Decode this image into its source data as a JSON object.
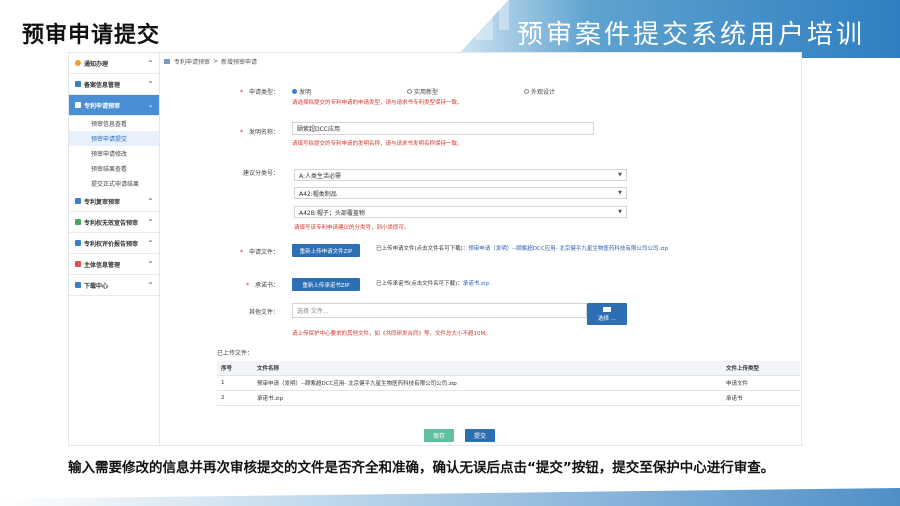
{
  "slide": {
    "title": "预审申请提交",
    "banner": "预审案件提交系统用户培训",
    "caption": "输入需要修改的信息并再次审核提交的文件是否齐全和准确，确认无误后点击“提交”按钮，提交至保护中心进行审查。"
  },
  "sidebar": {
    "items": [
      {
        "label": "通知办理",
        "icon": "bell-icon",
        "chevron": "^"
      },
      {
        "label": "备案信息管理",
        "icon": "folder-icon",
        "chevron": "^"
      },
      {
        "label": "专利申请预审",
        "icon": "document-icon",
        "chevron": "⌄"
      },
      {
        "label": "专利复审预审",
        "icon": "folder-icon",
        "chevron": "^"
      },
      {
        "label": "专利权无效宣告预审",
        "icon": "document-icon",
        "chevron": "^"
      },
      {
        "label": "专利权评价报告预审",
        "icon": "folder-icon",
        "chevron": "^"
      },
      {
        "label": "主体信息管理",
        "icon": "user-icon",
        "chevron": "^"
      },
      {
        "label": "下载中心",
        "icon": "download-icon",
        "chevron": "^"
      }
    ],
    "subitems": [
      "预审信息查看",
      "预审申请提交",
      "预审申请修改",
      "预审结果查看",
      "提交正式申请结果"
    ]
  },
  "breadcrumb": {
    "part1": "专利申请预审",
    "sep": ">",
    "part2": "新增预审申请"
  },
  "form": {
    "type_label": "申请类型：",
    "type_options": [
      "发明",
      "实用新型",
      "外观设计"
    ],
    "type_hint": "请选择拟提交的专利申请的申请类型，请与请求书专利类型保持一致。",
    "name_label": "发明名称：",
    "name_value": "颐紫超DCC应用",
    "name_hint": "请填写拟提交的专利申请的发明名称，请与请求书发明名称保持一致。",
    "class_label": "建议分类号：",
    "class_selects": [
      "A:人类生活必需",
      "A42:帽类制品",
      "A42B:帽子；头部覆盖物"
    ],
    "class_hint": "请填写该专利申请建议的分类号，到小类即可。",
    "app_file_label": "申请文件：",
    "app_file_button": "重新上传申请文件ZIP",
    "app_file_info_prefix": "已上传申请文件(点击文件名可下载)：",
    "app_file_info_link": "预审申请（发明）--颐紫超DCC应用- 北京健平九星生物医药科技有限公司公司.zip",
    "commit_label": "承诺书：",
    "commit_button": "重新上传承诺书ZIP",
    "commit_info_prefix": "已上传承诺书(点击文件名可下载)：",
    "commit_info_link": "承诺书.zip",
    "other_label": "其他文件：",
    "other_placeholder": "选择 文件...",
    "other_button": "选择 ...",
    "other_hint": "请上传保护中心要求的其他文件，如《共同研发合同》等，文件总大小不超10M。"
  },
  "uploaded": {
    "label": "已上传文件：",
    "headers": [
      "序号",
      "文件名称",
      "文件上传类型"
    ],
    "rows": [
      [
        "1",
        "预审申请（发明）--颐紫超DCC应用- 北京健平九星生物医药科技有限公司公司.zip",
        "申请文件"
      ],
      [
        "2",
        "承诺书.zip",
        "承诺书"
      ]
    ]
  },
  "actions": {
    "save": "保存",
    "submit": "提交"
  }
}
